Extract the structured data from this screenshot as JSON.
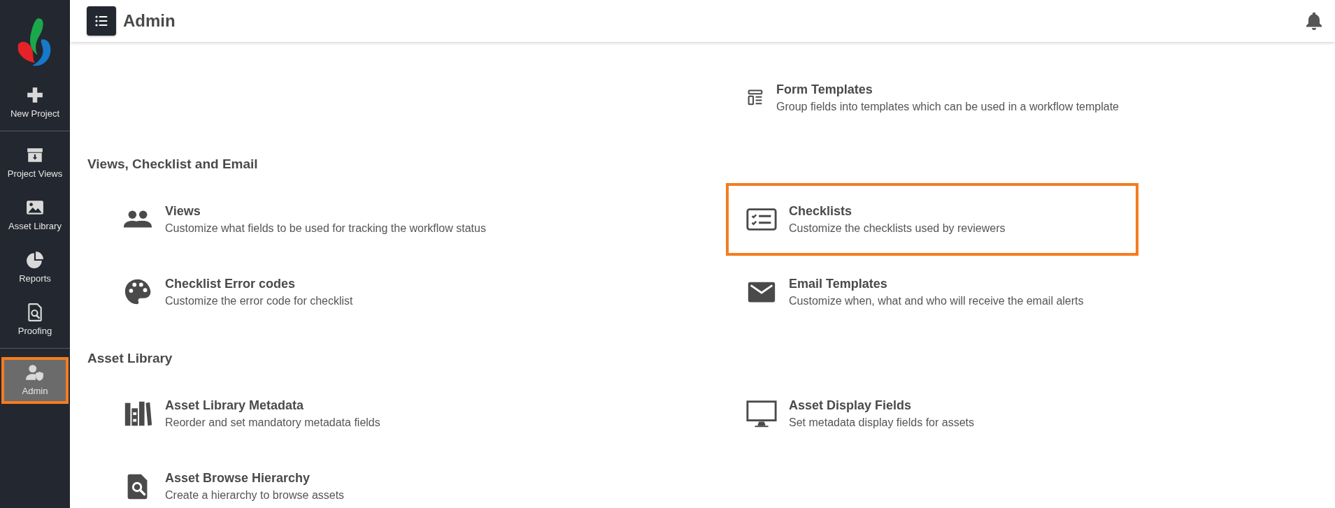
{
  "sidebar": {
    "groups": [
      [
        {
          "label": "New Project",
          "selected": false,
          "highlighted": false
        }
      ],
      [
        {
          "label": "Project Views",
          "selected": false,
          "highlighted": false
        },
        {
          "label": "Asset Library",
          "selected": false,
          "highlighted": false
        },
        {
          "label": "Reports",
          "selected": false,
          "highlighted": false
        },
        {
          "label": "Proofing",
          "selected": false,
          "highlighted": false
        }
      ],
      [
        {
          "label": "Admin",
          "selected": true,
          "highlighted": true
        }
      ]
    ]
  },
  "header": {
    "title": "Admin"
  },
  "sections": [
    {
      "rows": [
        {
          "right": {
            "title": "Form Templates",
            "description": "Group fields into templates which can be used in a workflow template",
            "highlighted": false
          }
        }
      ]
    },
    {
      "title": "Views, Checklist and Email",
      "rows": [
        {
          "left": {
            "title": "Views",
            "description": "Customize what fields to be used for tracking the workflow status",
            "highlighted": false
          },
          "right": {
            "title": "Checklists",
            "description": "Customize the checklists used by reviewers",
            "highlighted": true
          }
        },
        {
          "left": {
            "title": "Checklist Error codes",
            "description": "Customize the error code for checklist",
            "highlighted": false
          },
          "right": {
            "title": "Email Templates",
            "description": "Customize when, what and who will receive the email alerts",
            "highlighted": false
          }
        }
      ]
    },
    {
      "title": "Asset Library",
      "rows": [
        {
          "left": {
            "title": "Asset Library Metadata",
            "description": "Reorder and set mandatory metadata fields",
            "highlighted": false
          },
          "right": {
            "title": "Asset Display Fields",
            "description": "Set metadata display fields for assets",
            "highlighted": false
          }
        },
        {
          "left": {
            "title": "Asset Browse Hierarchy",
            "description": "Create a hierarchy to browse assets",
            "highlighted": false
          }
        }
      ]
    }
  ]
}
